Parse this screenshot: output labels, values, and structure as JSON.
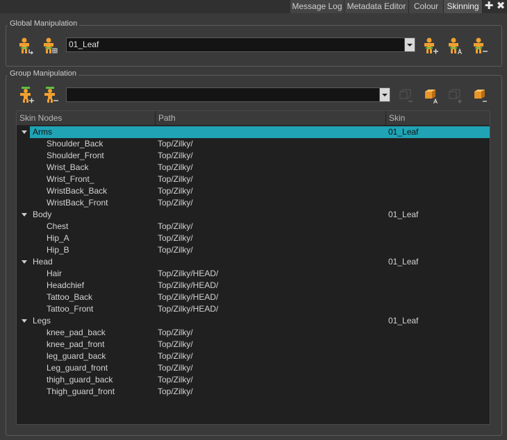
{
  "tabs": [
    {
      "label": "Message Log",
      "active": false
    },
    {
      "label": "Metadata Editor",
      "active": false
    },
    {
      "label": "Colour",
      "active": false
    },
    {
      "label": "Skinning",
      "active": true
    }
  ],
  "global": {
    "title": "Global Manipulation",
    "skin_value": "01_Leaf"
  },
  "group": {
    "title": "Group Manipulation",
    "group_value": ""
  },
  "columns": [
    "Skin Nodes",
    "Path",
    "Skin"
  ],
  "rows": [
    {
      "name": "Arms",
      "path": "",
      "skin": "01_Leaf",
      "group": true,
      "selected": true
    },
    {
      "name": "Shoulder_Back",
      "path": "Top/Zilky/",
      "skin": "",
      "group": false
    },
    {
      "name": "Shoulder_Front",
      "path": "Top/Zilky/",
      "skin": "",
      "group": false
    },
    {
      "name": "Wrist_Back",
      "path": "Top/Zilky/",
      "skin": "",
      "group": false
    },
    {
      "name": "Wrist_Front_",
      "path": "Top/Zilky/",
      "skin": "",
      "group": false
    },
    {
      "name": "WristBack_Back",
      "path": "Top/Zilky/",
      "skin": "",
      "group": false
    },
    {
      "name": "WristBack_Front",
      "path": "Top/Zilky/",
      "skin": "",
      "group": false
    },
    {
      "name": "Body",
      "path": "",
      "skin": "01_Leaf",
      "group": true
    },
    {
      "name": "Chest",
      "path": "Top/Zilky/",
      "skin": "",
      "group": false
    },
    {
      "name": "Hip_A",
      "path": "Top/Zilky/",
      "skin": "",
      "group": false
    },
    {
      "name": "Hip_B",
      "path": "Top/Zilky/",
      "skin": "",
      "group": false
    },
    {
      "name": "Head",
      "path": "",
      "skin": "01_Leaf",
      "group": true
    },
    {
      "name": "Hair",
      "path": "Top/Zilky/HEAD/",
      "skin": "",
      "group": false
    },
    {
      "name": "Headchief",
      "path": "Top/Zilky/HEAD/",
      "skin": "",
      "group": false
    },
    {
      "name": "Tattoo_Back",
      "path": "Top/Zilky/HEAD/",
      "skin": "",
      "group": false
    },
    {
      "name": "Tattoo_Front",
      "path": "Top/Zilky/HEAD/",
      "skin": "",
      "group": false
    },
    {
      "name": "Legs",
      "path": "",
      "skin": "01_Leaf",
      "group": true
    },
    {
      "name": "knee_pad_back",
      "path": "Top/Zilky/",
      "skin": "",
      "group": false
    },
    {
      "name": "knee_pad_front",
      "path": "Top/Zilky/",
      "skin": "",
      "group": false
    },
    {
      "name": "leg_guard_back",
      "path": "Top/Zilky/",
      "skin": "",
      "group": false
    },
    {
      "name": "Leg_guard_front",
      "path": "Top/Zilky/",
      "skin": "",
      "group": false
    },
    {
      "name": "thigh_guard_back",
      "path": "Top/Zilky/",
      "skin": "",
      "group": false
    },
    {
      "name": "Thigh_guard_front",
      "path": "Top/Zilky/",
      "skin": "",
      "group": false
    }
  ],
  "colors": {
    "selection": "#1fa3b5",
    "icon_orange": "#f0a030",
    "icon_green": "#5fbf3f"
  },
  "icons": {
    "global_left": [
      "skin-figure-arrow-icon",
      "skin-figure-grid-icon"
    ],
    "global_right": [
      "skin-figure-add-icon",
      "skin-figure-a-icon",
      "skin-figure-remove-icon"
    ],
    "group_left": [
      "group-figure-add-icon",
      "group-figure-remove-icon"
    ],
    "group_right": [
      "cube-remove-icon",
      "cube-a-icon",
      "cube-add-icon",
      "cube-minus-icon"
    ]
  }
}
